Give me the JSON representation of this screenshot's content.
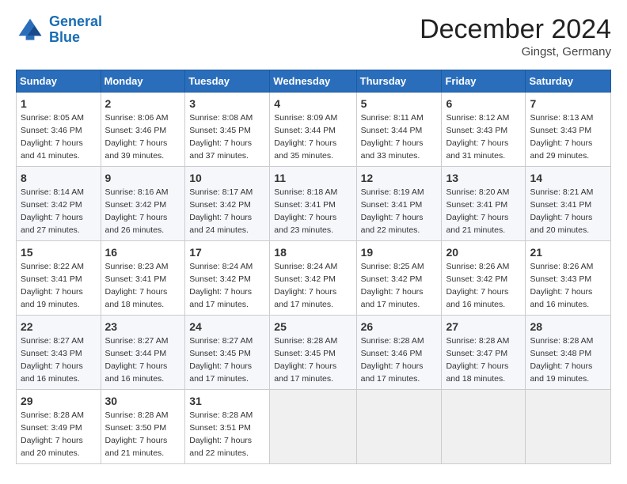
{
  "logo": {
    "line1": "General",
    "line2": "Blue"
  },
  "title": "December 2024",
  "location": "Gingst, Germany",
  "headers": [
    "Sunday",
    "Monday",
    "Tuesday",
    "Wednesday",
    "Thursday",
    "Friday",
    "Saturday"
  ],
  "weeks": [
    [
      {
        "day": "1",
        "sunrise": "8:05 AM",
        "sunset": "3:46 PM",
        "daylight": "7 hours and 41 minutes."
      },
      {
        "day": "2",
        "sunrise": "8:06 AM",
        "sunset": "3:46 PM",
        "daylight": "7 hours and 39 minutes."
      },
      {
        "day": "3",
        "sunrise": "8:08 AM",
        "sunset": "3:45 PM",
        "daylight": "7 hours and 37 minutes."
      },
      {
        "day": "4",
        "sunrise": "8:09 AM",
        "sunset": "3:44 PM",
        "daylight": "7 hours and 35 minutes."
      },
      {
        "day": "5",
        "sunrise": "8:11 AM",
        "sunset": "3:44 PM",
        "daylight": "7 hours and 33 minutes."
      },
      {
        "day": "6",
        "sunrise": "8:12 AM",
        "sunset": "3:43 PM",
        "daylight": "7 hours and 31 minutes."
      },
      {
        "day": "7",
        "sunrise": "8:13 AM",
        "sunset": "3:43 PM",
        "daylight": "7 hours and 29 minutes."
      }
    ],
    [
      {
        "day": "8",
        "sunrise": "8:14 AM",
        "sunset": "3:42 PM",
        "daylight": "7 hours and 27 minutes."
      },
      {
        "day": "9",
        "sunrise": "8:16 AM",
        "sunset": "3:42 PM",
        "daylight": "7 hours and 26 minutes."
      },
      {
        "day": "10",
        "sunrise": "8:17 AM",
        "sunset": "3:42 PM",
        "daylight": "7 hours and 24 minutes."
      },
      {
        "day": "11",
        "sunrise": "8:18 AM",
        "sunset": "3:41 PM",
        "daylight": "7 hours and 23 minutes."
      },
      {
        "day": "12",
        "sunrise": "8:19 AM",
        "sunset": "3:41 PM",
        "daylight": "7 hours and 22 minutes."
      },
      {
        "day": "13",
        "sunrise": "8:20 AM",
        "sunset": "3:41 PM",
        "daylight": "7 hours and 21 minutes."
      },
      {
        "day": "14",
        "sunrise": "8:21 AM",
        "sunset": "3:41 PM",
        "daylight": "7 hours and 20 minutes."
      }
    ],
    [
      {
        "day": "15",
        "sunrise": "8:22 AM",
        "sunset": "3:41 PM",
        "daylight": "7 hours and 19 minutes."
      },
      {
        "day": "16",
        "sunrise": "8:23 AM",
        "sunset": "3:41 PM",
        "daylight": "7 hours and 18 minutes."
      },
      {
        "day": "17",
        "sunrise": "8:24 AM",
        "sunset": "3:42 PM",
        "daylight": "7 hours and 17 minutes."
      },
      {
        "day": "18",
        "sunrise": "8:24 AM",
        "sunset": "3:42 PM",
        "daylight": "7 hours and 17 minutes."
      },
      {
        "day": "19",
        "sunrise": "8:25 AM",
        "sunset": "3:42 PM",
        "daylight": "7 hours and 17 minutes."
      },
      {
        "day": "20",
        "sunrise": "8:26 AM",
        "sunset": "3:42 PM",
        "daylight": "7 hours and 16 minutes."
      },
      {
        "day": "21",
        "sunrise": "8:26 AM",
        "sunset": "3:43 PM",
        "daylight": "7 hours and 16 minutes."
      }
    ],
    [
      {
        "day": "22",
        "sunrise": "8:27 AM",
        "sunset": "3:43 PM",
        "daylight": "7 hours and 16 minutes."
      },
      {
        "day": "23",
        "sunrise": "8:27 AM",
        "sunset": "3:44 PM",
        "daylight": "7 hours and 16 minutes."
      },
      {
        "day": "24",
        "sunrise": "8:27 AM",
        "sunset": "3:45 PM",
        "daylight": "7 hours and 17 minutes."
      },
      {
        "day": "25",
        "sunrise": "8:28 AM",
        "sunset": "3:45 PM",
        "daylight": "7 hours and 17 minutes."
      },
      {
        "day": "26",
        "sunrise": "8:28 AM",
        "sunset": "3:46 PM",
        "daylight": "7 hours and 17 minutes."
      },
      {
        "day": "27",
        "sunrise": "8:28 AM",
        "sunset": "3:47 PM",
        "daylight": "7 hours and 18 minutes."
      },
      {
        "day": "28",
        "sunrise": "8:28 AM",
        "sunset": "3:48 PM",
        "daylight": "7 hours and 19 minutes."
      }
    ],
    [
      {
        "day": "29",
        "sunrise": "8:28 AM",
        "sunset": "3:49 PM",
        "daylight": "7 hours and 20 minutes."
      },
      {
        "day": "30",
        "sunrise": "8:28 AM",
        "sunset": "3:50 PM",
        "daylight": "7 hours and 21 minutes."
      },
      {
        "day": "31",
        "sunrise": "8:28 AM",
        "sunset": "3:51 PM",
        "daylight": "7 hours and 22 minutes."
      },
      null,
      null,
      null,
      null
    ]
  ]
}
